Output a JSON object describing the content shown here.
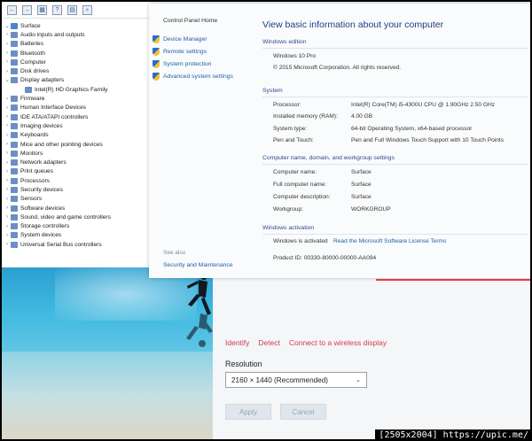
{
  "device_manager": {
    "items": [
      {
        "label": "Surface",
        "level": "root",
        "expanded": true
      },
      {
        "label": "Audio inputs and outputs",
        "level": "node"
      },
      {
        "label": "Batteries",
        "level": "node"
      },
      {
        "label": "Bluetooth",
        "level": "node"
      },
      {
        "label": "Computer",
        "level": "node"
      },
      {
        "label": "Disk drives",
        "level": "node"
      },
      {
        "label": "Display adapters",
        "level": "node",
        "expanded": true
      },
      {
        "label": "Intel(R) HD Graphics Family",
        "level": "child"
      },
      {
        "label": "Firmware",
        "level": "node"
      },
      {
        "label": "Human Interface Devices",
        "level": "node"
      },
      {
        "label": "IDE ATA/ATAPI controllers",
        "level": "node"
      },
      {
        "label": "Imaging devices",
        "level": "node"
      },
      {
        "label": "Keyboards",
        "level": "node"
      },
      {
        "label": "Mice and other pointing devices",
        "level": "node"
      },
      {
        "label": "Monitors",
        "level": "node"
      },
      {
        "label": "Network adapters",
        "level": "node"
      },
      {
        "label": "Print queues",
        "level": "node"
      },
      {
        "label": "Processors",
        "level": "node"
      },
      {
        "label": "Security devices",
        "level": "node"
      },
      {
        "label": "Sensors",
        "level": "node"
      },
      {
        "label": "Software devices",
        "level": "node"
      },
      {
        "label": "Sound, video and game controllers",
        "level": "node"
      },
      {
        "label": "Storage controllers",
        "level": "node"
      },
      {
        "label": "System devices",
        "level": "node"
      },
      {
        "label": "Universal Serial Bus controllers",
        "level": "node"
      }
    ]
  },
  "system": {
    "nav": {
      "home": "Control Panel Home",
      "links": [
        "Device Manager",
        "Remote settings",
        "System protection",
        "Advanced system settings"
      ],
      "see_also": "See also",
      "security": "Security and Maintenance"
    },
    "heading": "View basic information about your computer",
    "edition": {
      "title": "Windows edition",
      "name": "Windows 10 Pro",
      "copyright": "© 2015 Microsoft Corporation. All rights reserved."
    },
    "system": {
      "title": "System",
      "processor_label": "Processor:",
      "processor_value": "Intel(R) Core(TM) i5-4300U CPU @ 1.90GHz   2.50 GHz",
      "memory_label": "Installed memory (RAM):",
      "memory_value": "4.00 GB",
      "type_label": "System type:",
      "type_value": "64-bit Operating System, x64-based processor",
      "pen_label": "Pen and Touch:",
      "pen_value": "Pen and Full Windows Touch Support with 10 Touch Points"
    },
    "computer_name": {
      "title": "Computer name, domain, and workgroup settings",
      "name_label": "Computer name:",
      "name_value": "Surface",
      "full_label": "Full computer name:",
      "full_value": "Surface",
      "desc_label": "Computer description:",
      "desc_value": "Surface",
      "wg_label": "Workgroup:",
      "wg_value": "WORKGROUP"
    },
    "activation": {
      "title": "Windows activation",
      "status": "Windows is activated",
      "license_link": "Read the Microsoft Software License Terms",
      "product_id": "Product ID: 00330-80000-00000-AA094"
    }
  },
  "display_settings": {
    "links": [
      "Identify",
      "Detect",
      "Connect to a wireless display"
    ],
    "resolution_label": "Resolution",
    "resolution_value": "2160 × 1440 (Recommended)",
    "apply": "Apply",
    "cancel": "Cancel"
  },
  "footer": "[2505x2004] https://upic.me/",
  "colors": {
    "accent_link": "#1f5fa8",
    "settings_link": "#d13b4c",
    "heading": "#1e3e80"
  }
}
